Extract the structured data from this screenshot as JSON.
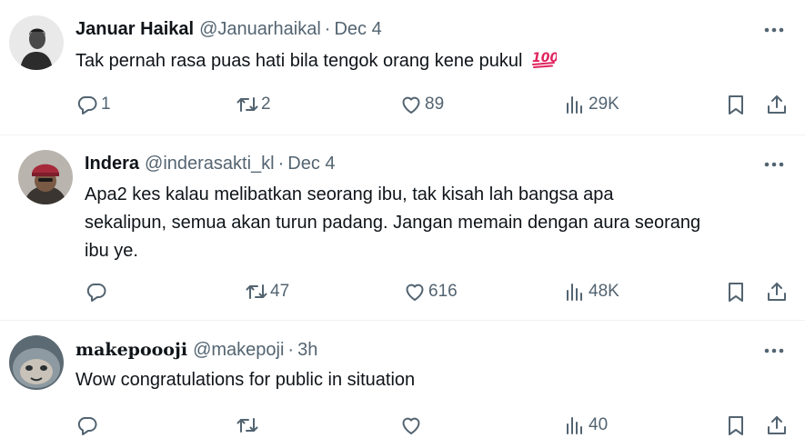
{
  "colors": {
    "text_primary": "#0f1419",
    "text_secondary": "#536471",
    "divider": "#eff3f4",
    "emoji_100": "#e0245e"
  },
  "tweets": [
    {
      "name": "Januar Haikal",
      "handle": "@Januarhaikal",
      "separator": "·",
      "time": "Dec 4",
      "text_lines": [
        "Tak pernah rasa puas hati bila tengok orang kene pukul"
      ],
      "emoji": "100",
      "stats": {
        "replies": "1",
        "retweets": "2",
        "likes": "89",
        "views": "29K"
      }
    },
    {
      "name": "Indera",
      "handle": "@inderasakti_kl",
      "separator": "·",
      "time": "Dec 4",
      "text_lines": [
        "Apa2 kes kalau melibatkan seorang ibu, tak kisah lah bangsa apa",
        "sekalipun, semua akan turun padang. Jangan memain dengan aura seorang",
        "ibu ye."
      ],
      "stats": {
        "replies": "",
        "retweets": "47",
        "likes": "616",
        "views": "48K"
      }
    },
    {
      "name": "makepoooji",
      "handle": "@makepoji",
      "separator": "·",
      "time": "3h",
      "text_lines": [
        "Wow congratulations for public in situation"
      ],
      "stats": {
        "replies": "",
        "retweets": "",
        "likes": "",
        "views": "40"
      }
    }
  ]
}
